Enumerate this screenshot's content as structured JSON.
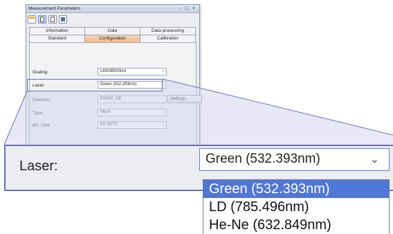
{
  "window": {
    "title": "Measurement Parameters",
    "controls": "- □ ×"
  },
  "tabs": {
    "row1": [
      "Information",
      "Data",
      "Data processing"
    ],
    "row2": [
      "Standard",
      "Configuration",
      "Calibration"
    ]
  },
  "form": {
    "grating": {
      "label": "Grating:",
      "value": "L600/B500nm"
    },
    "laser": {
      "label": "Laser:",
      "value": "Green (532.393nm)"
    },
    "detector": {
      "label": "Detector:",
      "value": "DU420_OE",
      "settings_button": "Settings..."
    },
    "type": {
      "label": "Type:",
      "value": "Micro"
    },
    "bs_dm": {
      "label": "BS / DM:",
      "value": "BS 30/70"
    }
  },
  "zoom": {
    "label": "Laser:",
    "selected": "Green (532.393nm)",
    "options": [
      "Green (532.393nm)",
      "LD (785.496nm)",
      "He-Ne (632.849nm)"
    ]
  },
  "colors": {
    "highlight": "#6c6eb9",
    "selection": "#4f77d6",
    "active_tab": "#efb98a"
  }
}
